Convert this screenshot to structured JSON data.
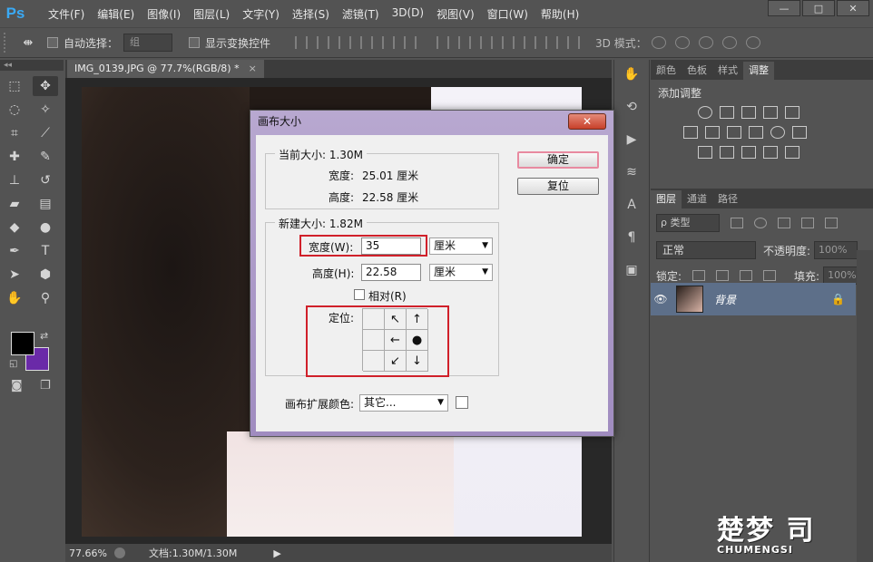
{
  "app": {
    "logo": "Ps"
  },
  "menu": [
    "文件(F)",
    "编辑(E)",
    "图像(I)",
    "图层(L)",
    "文字(Y)",
    "选择(S)",
    "滤镜(T)",
    "3D(D)",
    "视图(V)",
    "窗口(W)",
    "帮助(H)"
  ],
  "window_controls": {
    "minimize": "—",
    "maximize": "□",
    "close": "✕"
  },
  "options": {
    "auto_select_label": "自动选择：",
    "auto_select_value": "组",
    "show_transform_label": "显示变换控件",
    "mode_3d_label": "3D 模式："
  },
  "document": {
    "tab_label": "IMG_0139.JPG @ 77.7%(RGB/8) *",
    "tab_close": "×"
  },
  "status": {
    "zoom": "77.66%",
    "doc_info": "文档:1.30M/1.30M",
    "arrow": "▶"
  },
  "right_panel": {
    "top_tabs": [
      "颜色",
      "色板",
      "样式",
      "调整"
    ],
    "adjust_title": "添加调整",
    "layer_tabs": [
      "图层",
      "通道",
      "路径"
    ],
    "filter_label": "ρ 类型",
    "blend_mode": "正常",
    "opacity_label": "不透明度:",
    "opacity_value": "100%",
    "lock_label": "锁定:",
    "fill_label": "填充:",
    "fill_value": "100%",
    "layer_name": "背景",
    "lock_icon": "🔒"
  },
  "dialog": {
    "title": "画布大小",
    "close": "✕",
    "ok": "确定",
    "reset": "复位",
    "current_size_label": "当前大小: 1.30M",
    "current_width_label": "宽度:",
    "current_width_value": "25.01 厘米",
    "current_height_label": "高度:",
    "current_height_value": "22.58 厘米",
    "new_size_label": "新建大小: 1.82M",
    "new_width_label": "宽度(W):",
    "new_width_value": "35",
    "new_width_unit": "厘米",
    "new_height_label": "高度(H):",
    "new_height_value": "22.58",
    "new_height_unit": "厘米",
    "relative_label": "相对(R)",
    "anchor_label": "定位:",
    "anchor_cells": [
      "",
      "↖",
      "↑",
      "",
      "←",
      "●",
      "",
      "↙",
      "↓"
    ],
    "extension_color_label": "画布扩展颜色:",
    "extension_color_value": "其它..."
  },
  "watermark": {
    "big": "楚梦 司",
    "small": "CHUMENGSI"
  },
  "colors": {
    "foreground": "#000000",
    "background": "#6a2aa8",
    "highlight": "#d0202a"
  }
}
